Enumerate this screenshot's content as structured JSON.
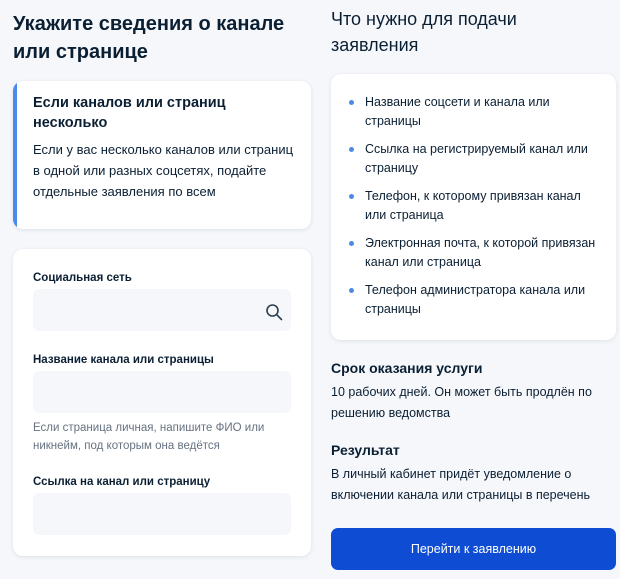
{
  "left": {
    "title": "Укажите сведения о канале или странице",
    "info_card": {
      "title": "Если каналов или страниц несколько",
      "text": "Если у вас несколько каналов или страниц в одной или разных соцсетях, подайте отдельные заявления по всем"
    },
    "form": {
      "social_label": "Социальная сеть",
      "social_value": "",
      "name_label": "Название канала или страницы",
      "name_value": "",
      "name_hint": "Если страница личная, напишите ФИО или никнейм, под которым она ведётся",
      "link_label": "Ссылка на канал или страницу",
      "link_value": ""
    }
  },
  "right": {
    "title": "Что нужно для подачи заявления",
    "requirements": [
      "Название соцсети и канала или страницы",
      "Ссылка на регистрируемый канал или страницу",
      "Телефон, к которому привязан канал или страница",
      "Электронная почта, к которой привязан канал или страница",
      "Телефон администратора канала или страницы"
    ],
    "term_title": "Срок оказания услуги",
    "term_text": "10 рабочих дней. Он может быть продлён по решению ведомства",
    "result_title": "Результат",
    "result_text": "В личный кабинет придёт уведомление о включении канала или страницы в перечень",
    "button_label": "Перейти к заявлению"
  },
  "colors": {
    "accent": "#4c8ae8",
    "primary_button": "#0d4cd3",
    "background": "#f5f7fb"
  },
  "icons": {
    "social_field": "search-icon"
  }
}
